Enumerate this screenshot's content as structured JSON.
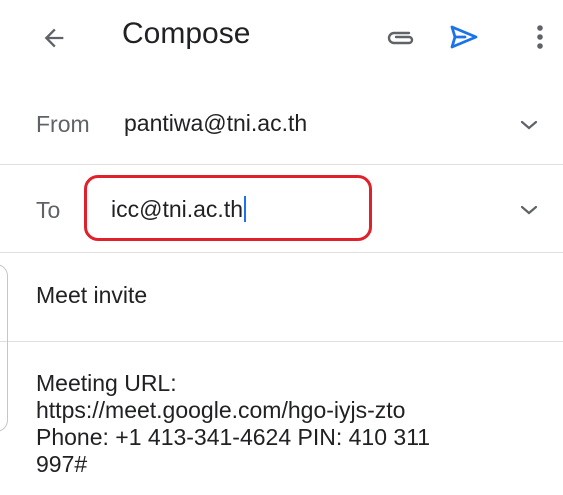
{
  "appbar": {
    "title": "Compose",
    "icons": {
      "back": "arrow-left-icon",
      "attach": "paperclip-icon",
      "send": "send-icon",
      "more": "more-vertical-icon"
    }
  },
  "header": {
    "from_label": "From",
    "from_value": "pantiwa@tni.ac.th",
    "to_label": "To",
    "to_value": "icc@tni.ac.th"
  },
  "subject": "Meet invite",
  "body": {
    "lines": [
      "Meeting URL:",
      "https://meet.google.com/hgo-iyjs-zto",
      "Phone: +1 413-341-4624 PIN: 410 311",
      "997#"
    ]
  },
  "colors": {
    "accent": "#1a73e8",
    "highlight": "#e0202a",
    "text": "#202124",
    "secondary_text": "#5f6368"
  }
}
